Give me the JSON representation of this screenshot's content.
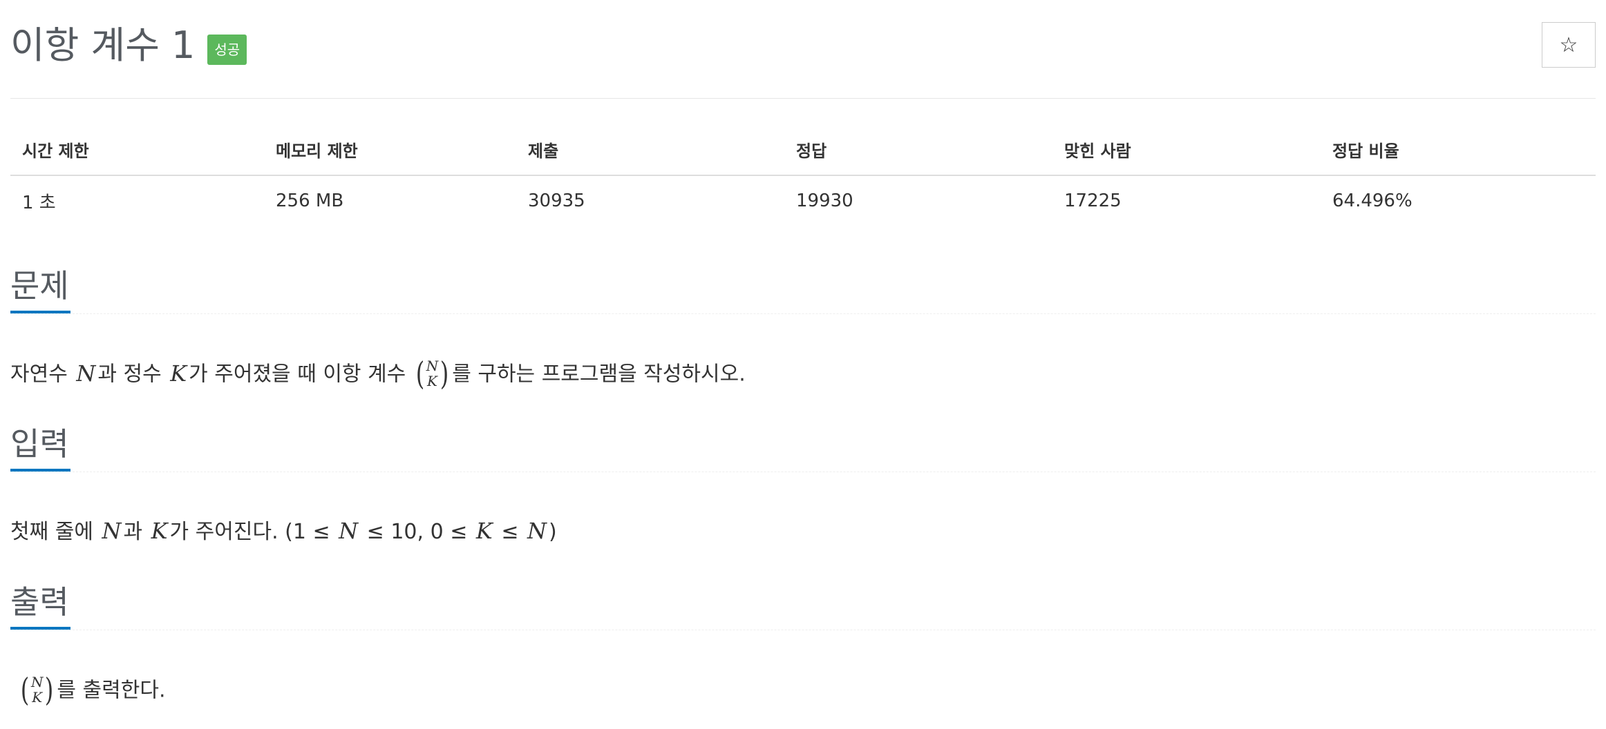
{
  "problem": {
    "title": "이항 계수 1",
    "status_badge": "성공",
    "star_icon": "☆"
  },
  "info_table": {
    "headers": [
      "시간 제한",
      "메모리 제한",
      "제출",
      "정답",
      "맞힌 사람",
      "정답 비율"
    ],
    "values": [
      "1 초",
      "256 MB",
      "30935",
      "19930",
      "17225",
      "64.496%"
    ]
  },
  "sections": {
    "description": {
      "title": "문제",
      "text_parts": [
        "자연수 ",
        "N",
        "과 정수 ",
        "K",
        "가 주어졌을 때 이항 계수 ",
        "를 구하는 프로그램을 작성하시오."
      ],
      "binom_top": "N",
      "binom_bottom": "K"
    },
    "input": {
      "title": "입력",
      "text_parts": [
        "첫째 줄에 ",
        "N",
        "과 ",
        "K",
        "가 주어진다. (1 ≤ ",
        "N",
        " ≤ 10, 0 ≤ ",
        "K",
        " ≤ ",
        "N",
        ")"
      ]
    },
    "output": {
      "title": "출력",
      "binom_top": "N",
      "binom_bottom": "K",
      "text": "를 출력한다."
    }
  },
  "colors": {
    "badge_success": "#5cb85c",
    "headline_underline": "#0076c0",
    "title_text": "#555a60"
  }
}
